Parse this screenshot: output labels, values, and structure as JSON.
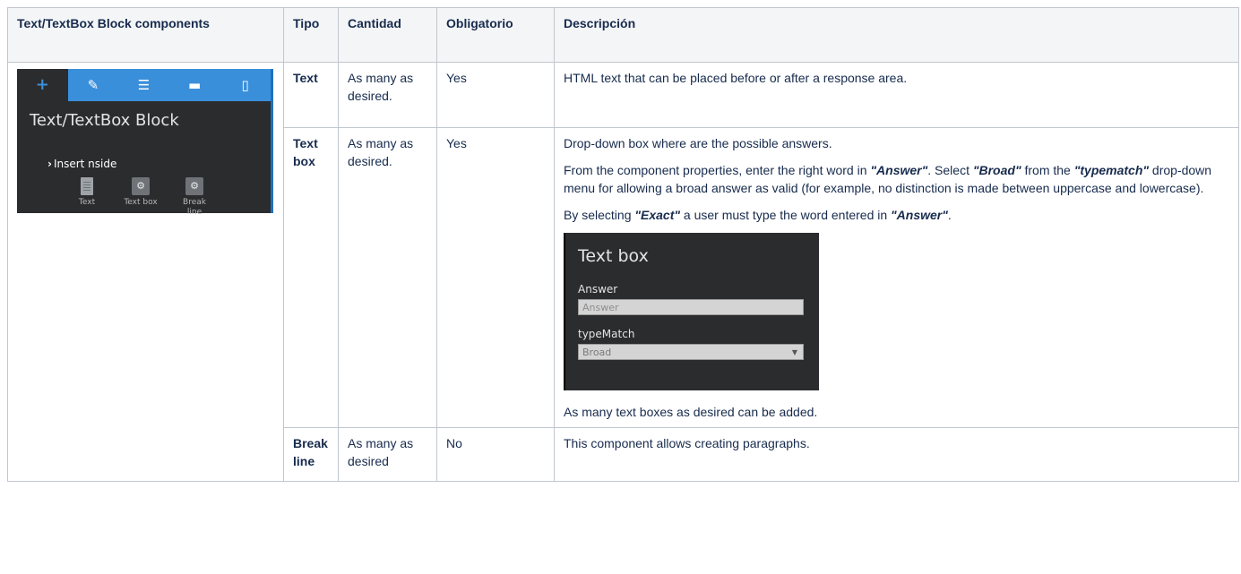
{
  "table": {
    "headers": {
      "components": "Text/TextBox Block components",
      "tipo": "Tipo",
      "cantidad": "Cantidad",
      "obligatorio": "Obligatorio",
      "descripcion": "Descripción"
    },
    "rows": [
      {
        "tipo": "Text",
        "cantidad": "As many as desired.",
        "obligatorio": "Yes",
        "descripcion": "HTML text that can be placed before or after a response area."
      },
      {
        "tipo": "Text box",
        "cantidad": "As many as desired.",
        "obligatorio": "Yes",
        "desc_p1": "Drop-down box where are the possible answers.",
        "desc_p2_a": "From the component properties, enter the right word in ",
        "desc_p2_b": "\"Answer\"",
        "desc_p2_c": ". Select ",
        "desc_p2_d": "\"Broad\"",
        "desc_p2_e": " from the ",
        "desc_p2_f": "\"typematch\"",
        "desc_p2_g": " drop-down menu for allowing a broad answer as valid (for example, no distinction is made between uppercase and lowercase).",
        "desc_p3_a": "By selecting ",
        "desc_p3_b": "\"Exact\"",
        "desc_p3_c": " a user must type the word entered in ",
        "desc_p3_d": "\"Answer\"",
        "desc_p3_e": ".",
        "desc_p4": "As many text boxes as desired can be added."
      },
      {
        "tipo": "Break line",
        "cantidad": "As many as desired",
        "obligatorio": "No",
        "descripcion": "This component allows creating paragraphs."
      }
    ]
  },
  "panel_image": {
    "tab_icons": [
      "plus-icon",
      "pencil-icon",
      "list-icon",
      "comment-icon",
      "mobile-icon"
    ],
    "tab_glyphs": [
      "+",
      "✎",
      "☰",
      "▬",
      "▯"
    ],
    "title": "Text/TextBox Block",
    "insert_label": "Insert nside",
    "components": [
      {
        "label": "Text",
        "icon": "document-icon"
      },
      {
        "label": "Text box",
        "icon": "gears-icon"
      },
      {
        "label": "Break line",
        "icon": "gears-icon"
      }
    ],
    "gear_glyph": "⚙",
    "accent": "#3a8fdb",
    "background": "#2b2c2e"
  },
  "textbox_image": {
    "title": "Text box",
    "answer_label": "Answer",
    "answer_placeholder": "Answer",
    "typematch_label": "typeMatch",
    "typematch_value": "Broad"
  }
}
